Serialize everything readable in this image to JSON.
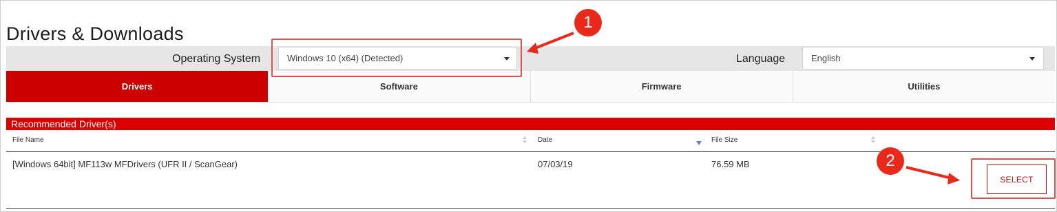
{
  "page": {
    "title": "Drivers & Downloads"
  },
  "filters": {
    "os_label": "Operating System",
    "os_value": "Windows 10 (x64) (Detected)",
    "language_label": "Language",
    "language_value": "English"
  },
  "tabs": [
    {
      "label": "Drivers",
      "active": true
    },
    {
      "label": "Software",
      "active": false
    },
    {
      "label": "Firmware",
      "active": false
    },
    {
      "label": "Utilities",
      "active": false
    }
  ],
  "recommended": {
    "header": "Recommended Driver(s)",
    "columns": [
      "File Name",
      "Date",
      "File Size"
    ],
    "rows": [
      {
        "file_name": "[Windows 64bit] MF113w MFDrivers (UFR II / ScanGear)",
        "date": "07/03/19",
        "file_size": "76.59 MB",
        "action": "SELECT"
      }
    ]
  },
  "annotations": {
    "step1": "1",
    "step2": "2"
  },
  "colors": {
    "brand_red": "#cc0000",
    "annotation_red": "#e8291c"
  }
}
